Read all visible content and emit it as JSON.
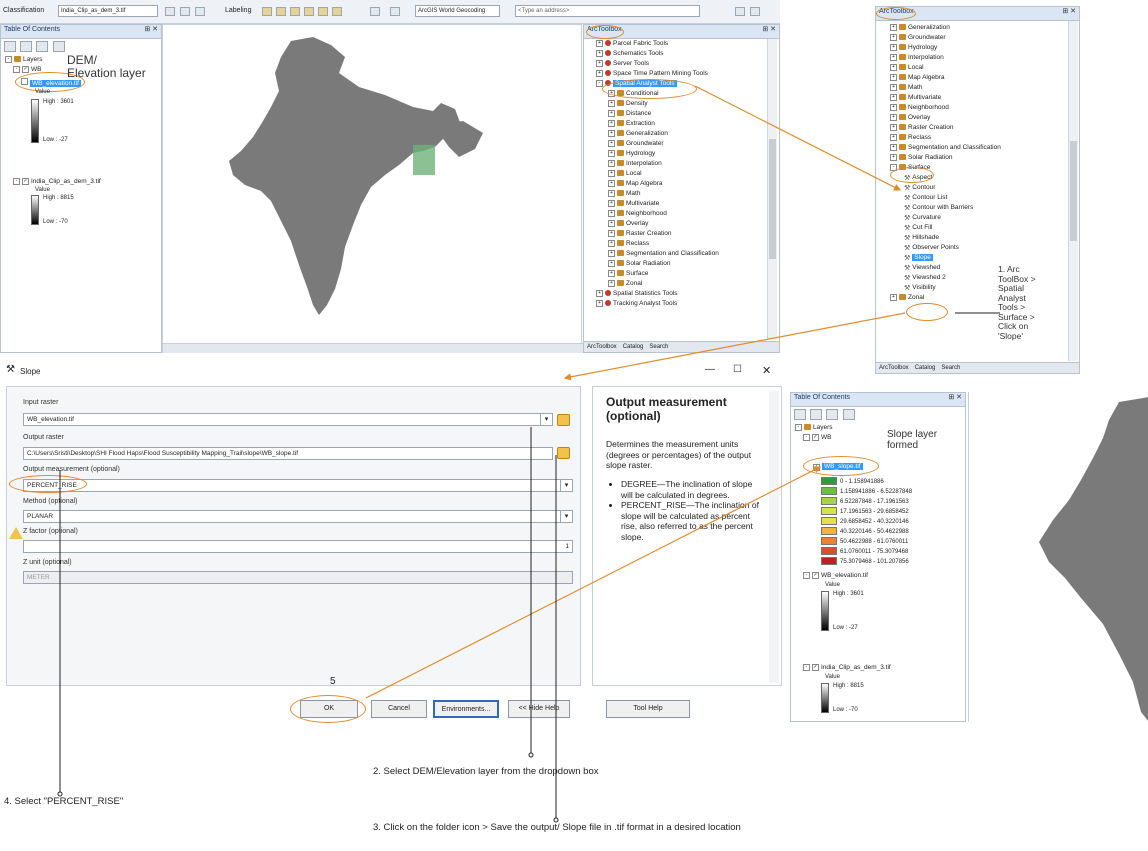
{
  "toolbar": {
    "classification": "Classification",
    "layer_select": "India_Clip_as_dem_3.tif",
    "labeling": "Labeling",
    "geocoding": "ArcGIS World Geocoding",
    "address_placeholder": "<Type an address>"
  },
  "toc1": {
    "title": "Table Of Contents",
    "layers": "Layers",
    "wb": "WB",
    "wb_elevation": "WB_elevation.tif",
    "value": "Value",
    "high": "High : 3601",
    "low": "Low : -27",
    "india_clip": "India_Clip_as_dem_3.tif",
    "value2": "Value",
    "high2": "High : 8815",
    "low2": "Low : -70",
    "annotation": "DEM/\nElevation layer"
  },
  "toolbox1": {
    "title": "ArcToolbox",
    "items": [
      "Parcel Fabric Tools",
      "Schematics Tools",
      "Server Tools",
      "Space Time Pattern Mining Tools",
      "Spatial Analyst Tools",
      "Conditional",
      "Density",
      "Distance",
      "Extraction",
      "Generalization",
      "Groundwater",
      "Hydrology",
      "Interpolation",
      "Local",
      "Map Algebra",
      "Math",
      "Multivariate",
      "Neighborhood",
      "Overlay",
      "Raster Creation",
      "Reclass",
      "Segmentation and Classification",
      "Solar Radiation",
      "Surface",
      "Zonal",
      "Spatial Statistics Tools",
      "Tracking Analyst Tools"
    ],
    "tabs": [
      "ArcToolbox",
      "Catalog",
      "Search"
    ]
  },
  "toolbox2": {
    "title": "ArcToolbox",
    "items": [
      "Generalization",
      "Groundwater",
      "Hydrology",
      "Interpolation",
      "Local",
      "Map Algebra",
      "Math",
      "Multivariate",
      "Neighborhood",
      "Overlay",
      "Raster Creation",
      "Reclass",
      "Segmentation and Classification",
      "Solar Radiation",
      "Surface"
    ],
    "surface_tools": [
      "Aspect",
      "Contour",
      "Contour List",
      "Contour with Barriers",
      "Curvature",
      "Cut Fill",
      "Hillshade",
      "Observer Points",
      "Slope",
      "Viewshed",
      "Viewshed 2",
      "Visibility"
    ],
    "zonal": "Zonal",
    "annotation": "1. Arc\nToolBox >\nSpatial\nAnalyst\nTools >\nSurface >\nClick on\n'Slope'",
    "tabs": [
      "ArcToolbox",
      "Catalog",
      "Search"
    ]
  },
  "dialog": {
    "title": "Slope",
    "input_raster_label": "Input raster",
    "input_raster_value": "WB_elevation.tif",
    "output_raster_label": "Output raster",
    "output_raster_value": "C:\\Users\\Sristi\\Desktop\\SHI Flood Haps\\Flood Susceptibility Mapping_Trail\\slope\\WB_slope.tif",
    "measurement_label": "Output measurement (optional)",
    "measurement_value": "PERCENT_RISE",
    "method_label": "Method (optional)",
    "method_value": "PLANAR",
    "zfactor_label": "Z factor (optional)",
    "zfactor_value": "1",
    "zunit_label": "Z unit (optional)",
    "zunit_value": "METER",
    "ok": "OK",
    "cancel": "Cancel",
    "environments": "Environments...",
    "hide_help": "<< Hide Help",
    "tool_help": "Tool Help",
    "step5": "5"
  },
  "help": {
    "title": "Output measurement (optional)",
    "body": "Determines the measurement units (degrees or percentages) of the output slope raster.",
    "bullet1": "DEGREE—The inclination of slope will be calculated in degrees.",
    "bullet2": "PERCENT_RISE—The inclination of slope will be calculated as percent rise, also referred to as the percent slope."
  },
  "toc2": {
    "title": "Table Of Contents",
    "layers": "Layers",
    "wb": "WB",
    "wb_slope": "WB_slope.tif",
    "annotation": "Slope layer\nformed",
    "classes": [
      {
        "label": "0 - 1.158941886",
        "color": "#2d9a3e"
      },
      {
        "label": "1.158941886 - 6.52287848",
        "color": "#6cbf3f"
      },
      {
        "label": "6.52287848 - 17.1961563",
        "color": "#a8d448"
      },
      {
        "label": "17.1961563 - 29.6858452",
        "color": "#d2e34d"
      },
      {
        "label": "29.6858452 - 40.3220146",
        "color": "#e8e04a"
      },
      {
        "label": "40.3220146 - 50.4622988",
        "color": "#efb63f"
      },
      {
        "label": "50.4622988 - 61.0760011",
        "color": "#e88433"
      },
      {
        "label": "61.0760011 - 75.3079468",
        "color": "#d94f2b"
      },
      {
        "label": "75.3079468 - 101.207856",
        "color": "#c01f23"
      }
    ],
    "wb_elevation": "WB_elevation.tif",
    "value": "Value",
    "high": "High : 3601",
    "low": "Low : -27",
    "india_clip": "India_Clip_as_dem_3.tif",
    "value2": "Value",
    "high2": "High : 8815",
    "low2": "Low : -70"
  },
  "annotations": {
    "step2": "2. Select DEM/Elevation layer from the dropdown box",
    "step3": "3. Click on the folder icon > Save the output/ Slope file in .tif format in a desired location",
    "step4": "4. Select \"PERCENT_RISE\""
  },
  "colors": {
    "callout": "#e08a2c",
    "selection": "#3399ff",
    "map_fill": "#7a7a7a"
  }
}
